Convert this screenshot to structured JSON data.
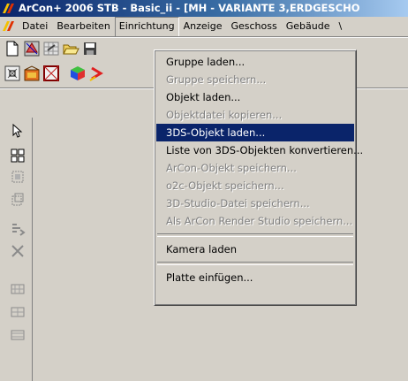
{
  "window": {
    "title": "ArCon+ 2006 STB - Basic_ii - [MH - VARIANTE 3,ERDGESCHO"
  },
  "menubar": {
    "items": [
      {
        "label": "Datei"
      },
      {
        "label": "Bearbeiten"
      },
      {
        "label": "Einrichtung"
      },
      {
        "label": "Anzeige"
      },
      {
        "label": "Geschoss"
      },
      {
        "label": "Gebäude"
      },
      {
        "label": "\\"
      }
    ],
    "open_menu": "Einrichtung"
  },
  "dropdown": {
    "items": [
      {
        "label": "Gruppe laden...",
        "enabled": true
      },
      {
        "label": "Gruppe speichern...",
        "enabled": false
      },
      {
        "label": "Objekt laden...",
        "enabled": true
      },
      {
        "label": "Objektdatei kopieren...",
        "enabled": false
      },
      {
        "label": "3DS-Objekt laden...",
        "enabled": true,
        "selected": true
      },
      {
        "label": "Liste von 3DS-Objekten konvertieren...",
        "enabled": true
      },
      {
        "label": "ArCon-Objekt speichern...",
        "enabled": false
      },
      {
        "label": "o2c-Objekt speichern...",
        "enabled": false
      },
      {
        "label": "3D-Studio-Datei speichern...",
        "enabled": false
      },
      {
        "label": "Als ArCon Render Studio speichern...",
        "enabled": false
      },
      {
        "label": "Kamera laden",
        "enabled": true
      },
      {
        "label": "Platte einfügen...",
        "enabled": true
      }
    ]
  },
  "colors": {
    "face": "#d4d0c8",
    "title_start": "#0a246a",
    "highlight": "#0a246a",
    "disabled_text": "#808080"
  },
  "icons": {
    "toolbar1": [
      "new-document-icon",
      "plan-view-icon",
      "grid-icon",
      "open-folder-icon",
      "save-icon"
    ],
    "toolbar2": [
      "select-frame-icon",
      "room-icon",
      "wall-icon",
      "3d-cube-icon",
      "arrow-red-icon"
    ],
    "left_toolbar": [
      "pointer-icon",
      "group-icon",
      "element-icon",
      "element-alt-icon",
      "move-icon",
      "delete-icon",
      "measure-a-icon",
      "measure-b-icon",
      "measure-c-icon"
    ]
  }
}
